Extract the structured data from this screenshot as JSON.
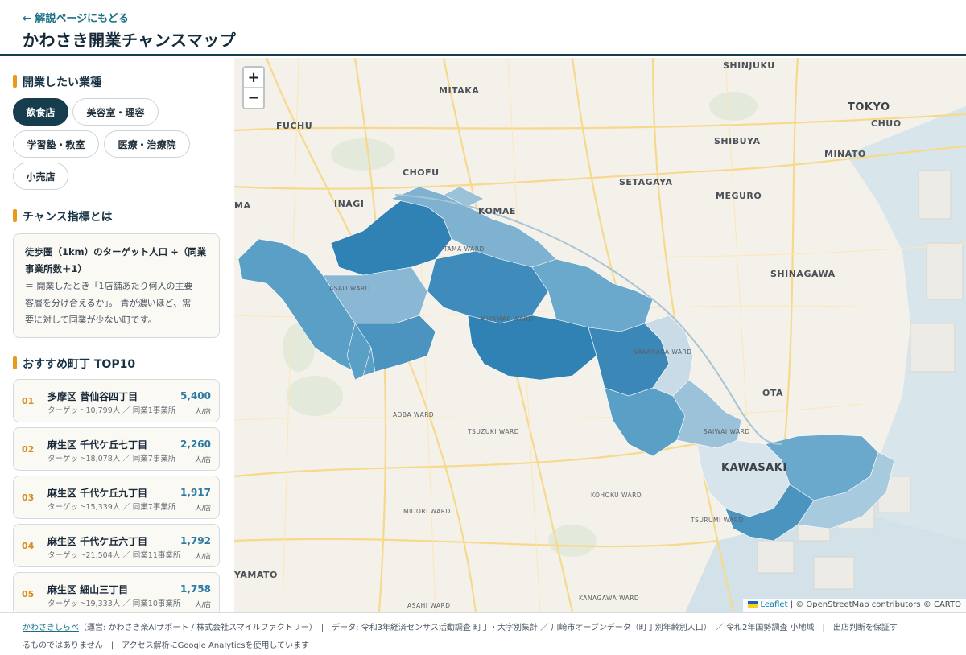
{
  "header": {
    "back_link": "← 解説ページにもどる",
    "title": "かわさき開業チャンスマップ"
  },
  "sidebar": {
    "business_section_title": "開業したい業種",
    "business_types": [
      "飲食店",
      "美容室・理容",
      "学習塾・教室",
      "医療・治療院",
      "小売店"
    ],
    "selected_business": "飲食店",
    "index_section_title": "チャンス指標とは",
    "index_formula_line1": "徒歩圏（1km）のターゲット人口 ÷（同業",
    "index_formula_line2": "事業所数＋1）",
    "index_text_line1": "＝ 開業したとき「1店舗あたり何人の主要",
    "index_text_line2": "客層を分け合えるか」。 青が濃いほど、需",
    "index_text_line3": "要に対して同業が少ない町です。",
    "ranking_section_title": "おすすめ町丁 TOP10",
    "ranking": [
      {
        "rank": "01",
        "name": "多摩区 菅仙谷四丁目",
        "detail": "ターゲット10,799人 ／ 同業1事業所",
        "score": "5,400",
        "unit": "人/店"
      },
      {
        "rank": "02",
        "name": "麻生区 千代ケ丘七丁目",
        "detail": "ターゲット18,078人 ／ 同業7事業所",
        "score": "2,260",
        "unit": "人/店"
      },
      {
        "rank": "03",
        "name": "麻生区 千代ケ丘九丁目",
        "detail": "ターゲット15,339人 ／ 同業7事業所",
        "score": "1,917",
        "unit": "人/店"
      },
      {
        "rank": "04",
        "name": "麻生区 千代ケ丘六丁目",
        "detail": "ターゲット21,504人 ／ 同業11事業所",
        "score": "1,792",
        "unit": "人/店"
      },
      {
        "rank": "05",
        "name": "麻生区 細山三丁目",
        "detail": "ターゲット19,333人 ／ 同業10事業所",
        "score": "1,758",
        "unit": "人/店"
      }
    ]
  },
  "map": {
    "zoom_in": "+",
    "zoom_out": "−",
    "labels": {
      "shinjuku": "SHINJUKU",
      "mitaka": "MITAKA",
      "tokyo": "TOKYO",
      "chuo": "CHUO",
      "fuchu": "FUCHU",
      "shibuya": "SHIBUYA",
      "minato": "MINATO",
      "chofu": "CHOFU",
      "setagaya": "SETAGAYA",
      "inagi": "INAGI",
      "komae": "KOMAE",
      "meguro": "MEGURO",
      "ma": "MA",
      "shinagawa": "SHINAGAWA",
      "ota": "OTA",
      "kawasaki": "KAWASAKI",
      "yamato": "YAMATO",
      "tama_ward": "TAMA WARD",
      "asao_ward": "ASAO WARD",
      "miyamae_ward": "MIYAMAE WARD",
      "nakahara_ward": "NAKAHARA WARD",
      "saiwai_ward": "SAIWAI WARD",
      "aoba_ward": "AOBA WARD",
      "tsuzuki_ward": "TSUZUKI WARD",
      "kohoku_ward": "KOHOKU WARD",
      "midori_ward": "MIDORI WARD",
      "tsurumi_ward": "TSURUMI WARD",
      "asahi_ward": "ASAHI WARD",
      "kanagawa_ward": "KANAGAWA WARD"
    },
    "attribution_leaflet": "Leaflet",
    "attribution_rest": " | © OpenStreetMap contributors © CARTO"
  },
  "footer": {
    "brand": "かわさきしらべ",
    "line1_rest": "（運営: かわさき楽AIサポート / 株式会社スマイルファクトリー）　|　データ: 令和3年経済センサス活動調査 町丁・大字別集計 ／ 川崎市オープンデータ（町丁別年齢別人口）　／ 令和2年国勢調査 小地域　|　出店判断を保証す",
    "line2": "るものではありません　|　アクセス解析にGoogle Analyticsを使用しています"
  },
  "colors": {
    "header_border": "#163d4e",
    "accent": "#e89a1a",
    "chip_active": "#163d4e",
    "score_blue": "#2b7aa6",
    "choropleth_dark": "#2f82b3",
    "choropleth_light": "#cfe0ea"
  }
}
